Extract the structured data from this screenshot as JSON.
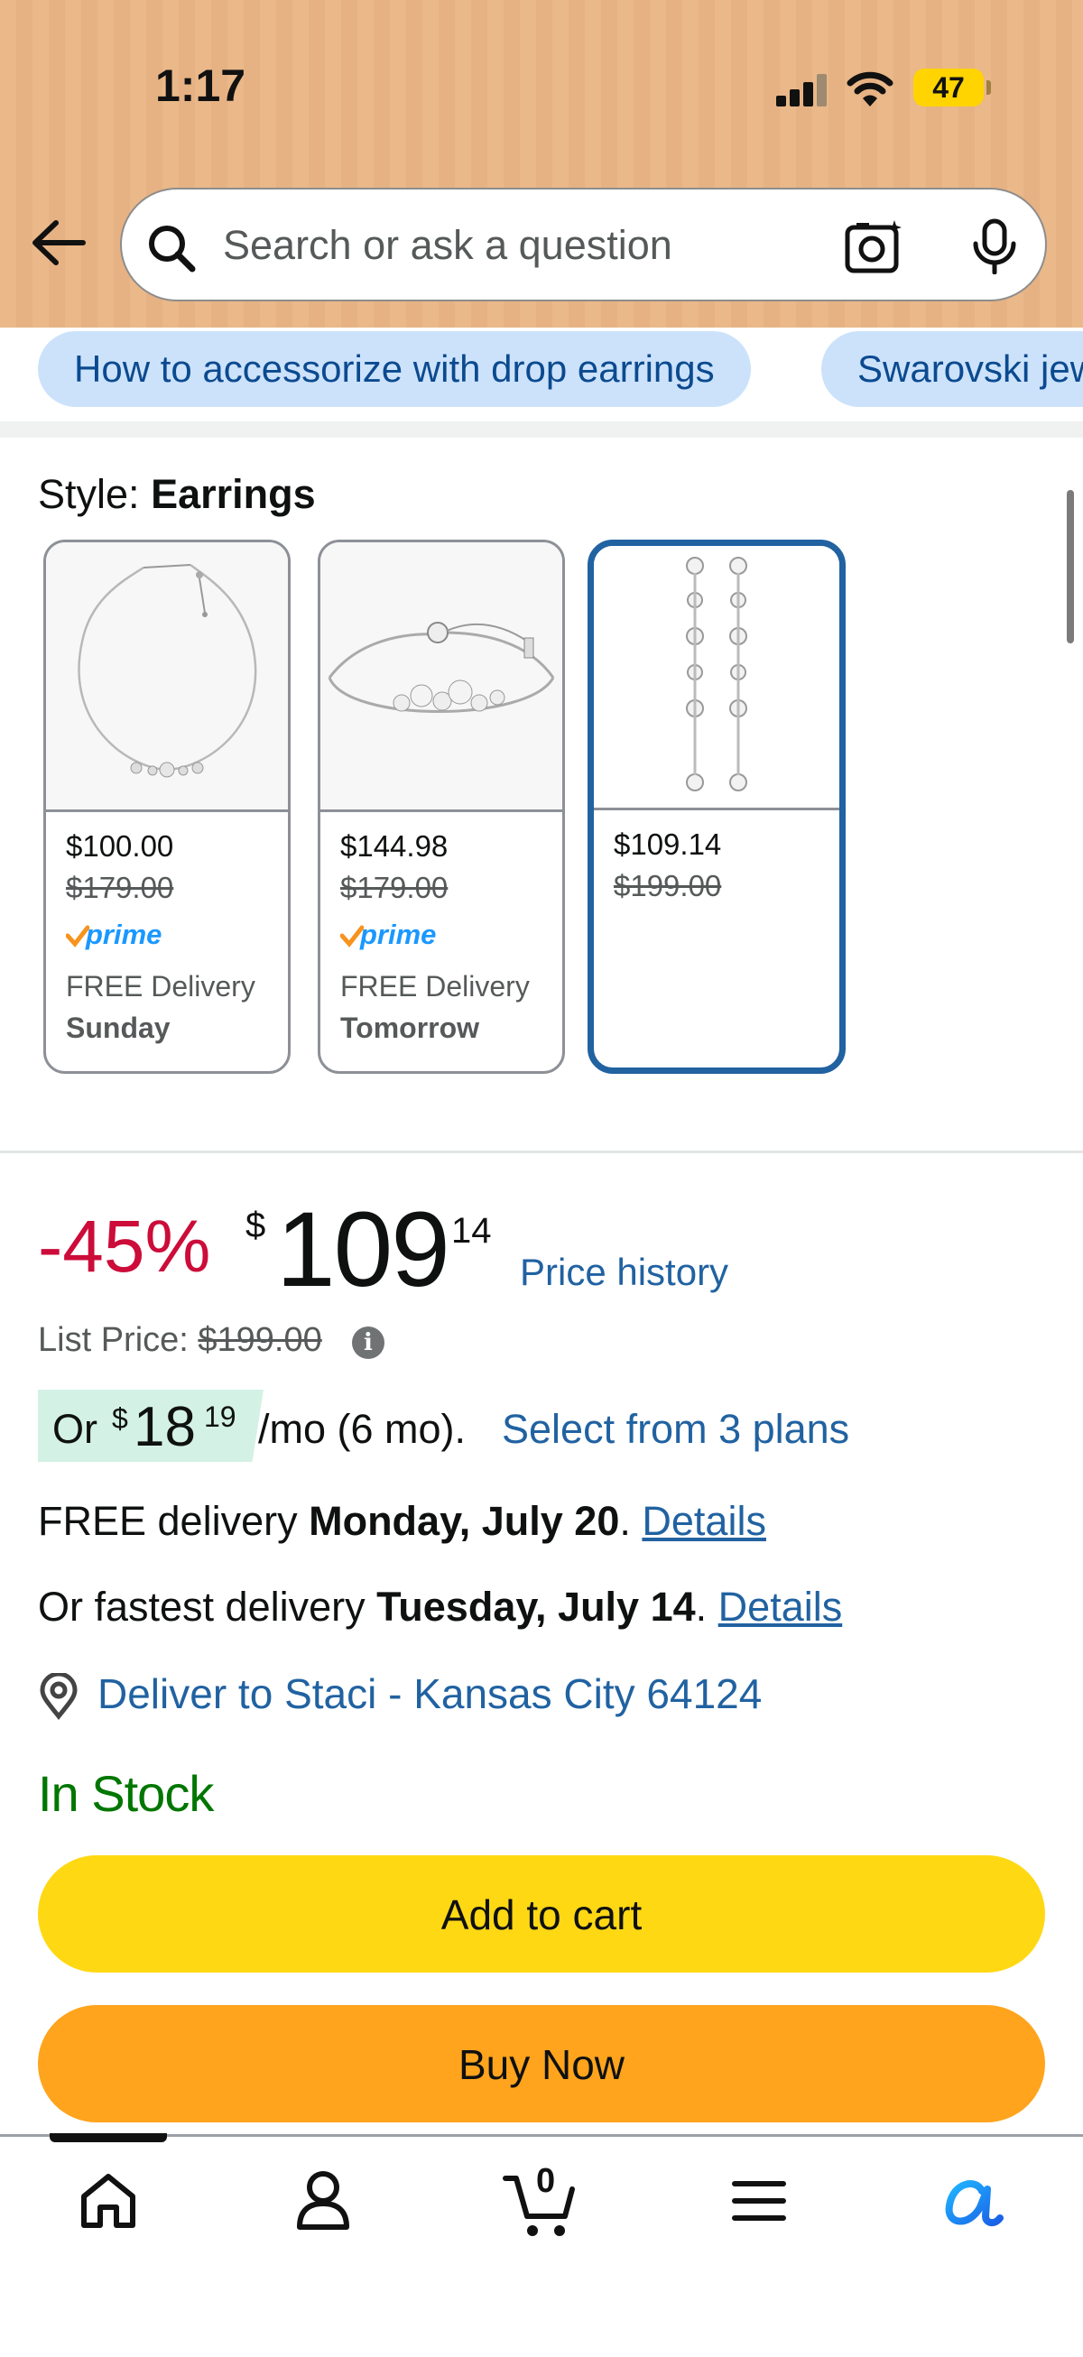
{
  "status_bar": {
    "time": "1:17",
    "battery": "47"
  },
  "search": {
    "placeholder": "Search or ask a question"
  },
  "suggestions": [
    "How to accessorize with drop earrings",
    "Swarovski jewelry"
  ],
  "style": {
    "label": "Style:",
    "value": "Earrings",
    "options": [
      {
        "price": "$100.00",
        "list_price": "$179.00",
        "prime": "prime",
        "delivery": "FREE Delivery",
        "day": "Sunday",
        "image": "necklace"
      },
      {
        "price": "$144.98",
        "list_price": "$179.00",
        "prime": "prime",
        "delivery": "FREE Delivery",
        "day": "Tomorrow",
        "image": "bracelet"
      },
      {
        "price": "$109.14",
        "list_price": "$199.00",
        "image": "earrings",
        "selected": true
      }
    ]
  },
  "price": {
    "discount": "-45%",
    "currency": "$",
    "whole": "109",
    "fraction": "14",
    "history_link": "Price history",
    "list_label": "List Price:",
    "list_value": "$199.00"
  },
  "installment": {
    "or": "Or",
    "currency": "$",
    "whole": "18",
    "fraction": "19",
    "terms": "/mo (6 mo).",
    "plans_link": "Select from 3 plans"
  },
  "delivery": {
    "free_prefix": "FREE delivery",
    "free_date": "Monday, July 20",
    "fast_prefix": "Or fastest delivery",
    "fast_date": "Tuesday, July 14",
    "details_link": "Details",
    "deliver_to": "Deliver to Staci - Kansas City 64124"
  },
  "stock": "In Stock",
  "buttons": {
    "add_to_cart": "Add to cart",
    "buy_now": "Buy Now"
  },
  "nav": {
    "cart_count": "0",
    "items": [
      "home-icon",
      "account-icon",
      "cart-icon",
      "menu-icon",
      "rufus-icon"
    ]
  },
  "colors": {
    "accent_link": "#2162a1",
    "discount": "#cc0c39",
    "in_stock": "#007600",
    "add_to_cart": "#ffd814",
    "buy_now": "#ffa41c",
    "selected_border": "#2162a1"
  }
}
